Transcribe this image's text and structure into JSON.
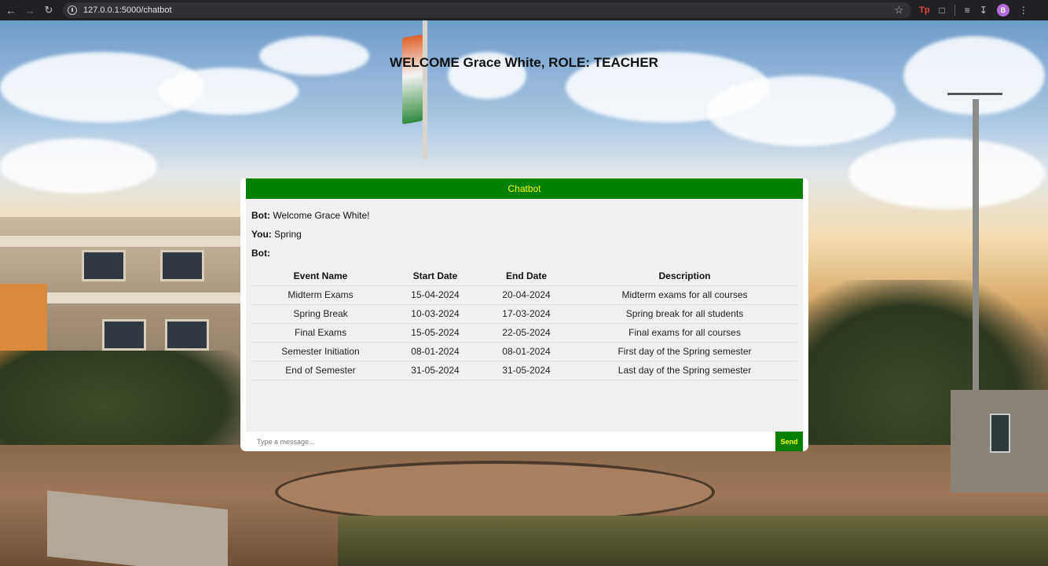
{
  "browser": {
    "url": "127.0.0.1:5000/chatbot",
    "profile_initial": "B",
    "ext_label": "Tp"
  },
  "page": {
    "welcome": "WELCOME Grace White, ROLE: TEACHER"
  },
  "chat": {
    "header": "Chatbot",
    "messages": [
      {
        "sender": "Bot:",
        "text": "Welcome Grace White!"
      },
      {
        "sender": "You:",
        "text": "Spring"
      },
      {
        "sender": "Bot:",
        "text": ""
      }
    ],
    "table": {
      "headers": [
        "Event Name",
        "Start Date",
        "End Date",
        "Description"
      ],
      "rows": [
        [
          "Midterm Exams",
          "15-04-2024",
          "20-04-2024",
          "Midterm exams for all courses"
        ],
        [
          "Spring Break",
          "10-03-2024",
          "17-03-2024",
          "Spring break for all students"
        ],
        [
          "Final Exams",
          "15-05-2024",
          "22-05-2024",
          "Final exams for all courses"
        ],
        [
          "Semester Initiation",
          "08-01-2024",
          "08-01-2024",
          "First day of the Spring semester"
        ],
        [
          "End of Semester",
          "31-05-2024",
          "31-05-2024",
          "Last day of the Spring semester"
        ]
      ]
    },
    "input_placeholder": "Type a message...",
    "input_value": "",
    "send_label": "Send"
  }
}
